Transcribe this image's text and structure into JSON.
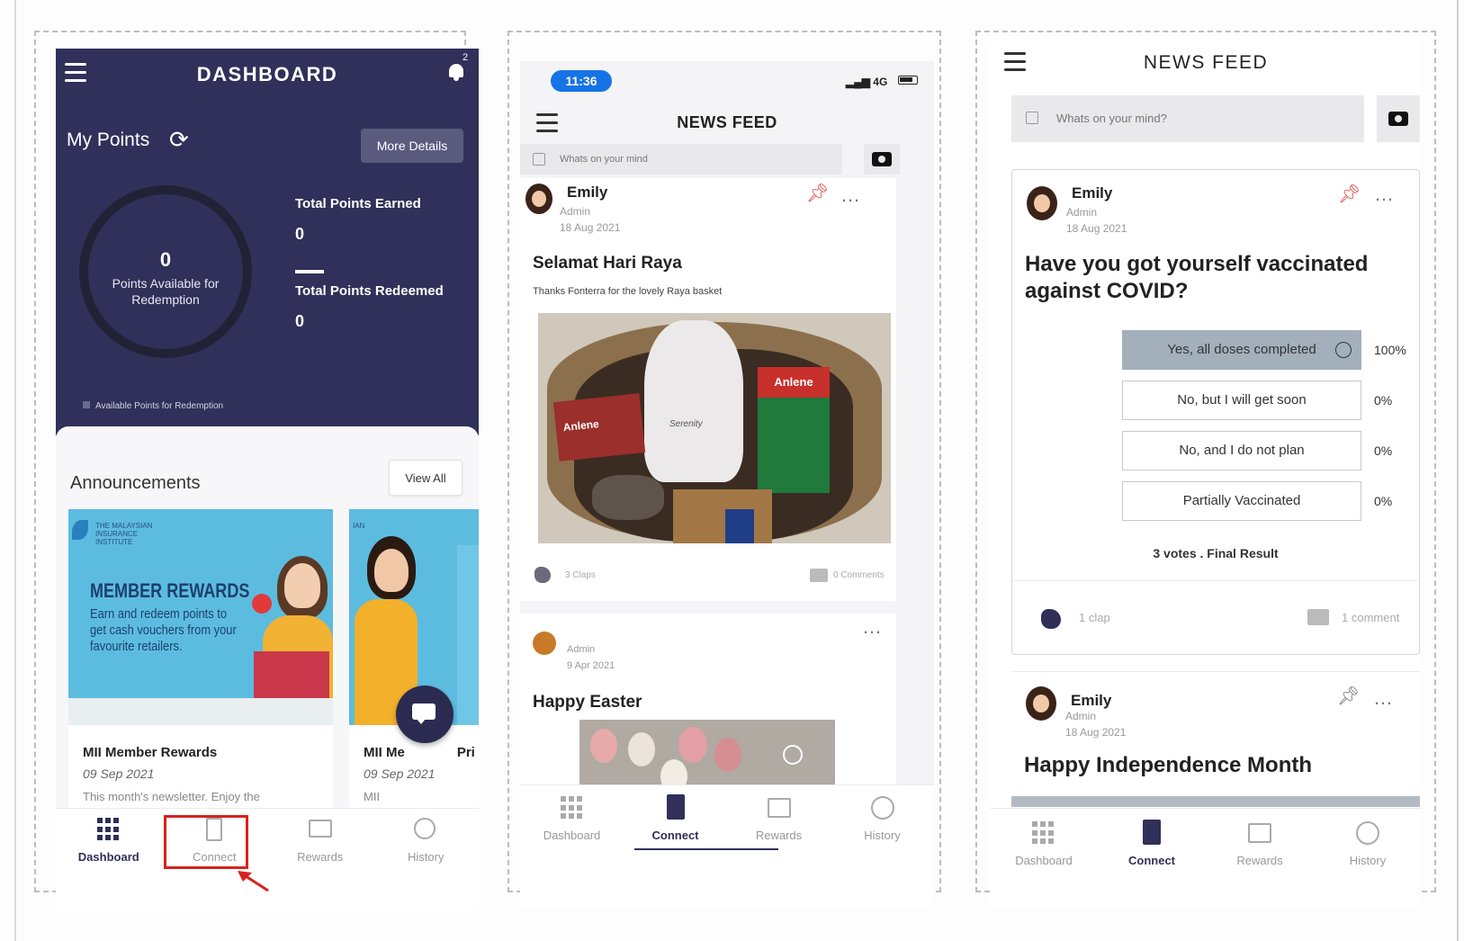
{
  "panel1": {
    "header": {
      "title": "DASHBOARD",
      "notification_count": "2"
    },
    "points": {
      "title": "My Points",
      "more_details": "More Details",
      "available_value": "0",
      "available_label": "Points Available for Redemption",
      "earned_label": "Total Points Earned",
      "earned_value": "0",
      "redeemed_label": "Total Points Redeemed",
      "redeemed_value": "0",
      "legend": "Available Points for Redemption"
    },
    "announcements": {
      "title": "Announcements",
      "view_all": "View All",
      "cards": [
        {
          "brand": "THE MALAYSIAN INSURANCE INSTITUTE",
          "banner_heading": "MEMBER REWARDS",
          "banner_text": "Earn and redeem points to get cash vouchers from your favourite retailers.",
          "title": "MII Member Rewards",
          "date": "09 Sep 2021",
          "snippet": "This month's newsletter. Enjoy the"
        },
        {
          "brand": "IAN",
          "title": "MII Me",
          "title_suffix": "Pri",
          "date": "09 Sep 2021",
          "snippet": "MII"
        }
      ]
    },
    "nav": [
      {
        "label": "Dashboard",
        "icon": "grid-icon",
        "active": true
      },
      {
        "label": "Connect",
        "icon": "document-icon",
        "active": false
      },
      {
        "label": "Rewards",
        "icon": "gift-icon",
        "active": false
      },
      {
        "label": "History",
        "icon": "history-icon",
        "active": false
      }
    ],
    "highlight_color": "#d9221e"
  },
  "panel2": {
    "status": {
      "time": "11:36",
      "network": "4G"
    },
    "title": "NEWS FEED",
    "compose_placeholder": "Whats on your mind",
    "post1": {
      "author": "Emily",
      "role": "Admin",
      "date": "18 Aug 2021",
      "title": "Selamat Hari Raya",
      "caption": "Thanks Fonterra for the lovely Raya basket",
      "photo_labels": {
        "left_box": "Anlene",
        "right_box": "Anlene",
        "tin": "Serenity"
      },
      "claps": "3 Claps",
      "comments": "0 Comments"
    },
    "post2": {
      "role": "Admin",
      "date": "9 Apr 2021",
      "title": "Happy Easter"
    },
    "nav": [
      {
        "label": "Dashboard",
        "icon": "grid-icon",
        "active": false
      },
      {
        "label": "Connect",
        "icon": "document-icon",
        "active": true
      },
      {
        "label": "Rewards",
        "icon": "gift-icon",
        "active": false
      },
      {
        "label": "History",
        "icon": "history-icon",
        "active": false
      }
    ]
  },
  "panel3": {
    "title": "NEWS FEED",
    "compose_placeholder": "Whats on your mind?",
    "post1": {
      "author": "Emily",
      "role": "Admin",
      "date": "18 Aug 2021",
      "question": "Have you got yourself vaccinated against COVID?",
      "options": [
        {
          "label": "Yes, all doses completed",
          "pct": "100%",
          "selected": true
        },
        {
          "label": "No, but I will get soon",
          "pct": "0%",
          "selected": false
        },
        {
          "label": "No, and I do not plan",
          "pct": "0%",
          "selected": false
        },
        {
          "label": "Partially Vaccinated",
          "pct": "0%",
          "selected": false
        }
      ],
      "result": "3 votes . Final Result",
      "claps": "1 clap",
      "comments": "1 comment"
    },
    "post2": {
      "author": "Emily",
      "role": "Admin",
      "date": "18 Aug 2021",
      "title": "Happy Independence Month"
    },
    "nav": [
      {
        "label": "Dashboard",
        "icon": "grid-icon",
        "active": false
      },
      {
        "label": "Connect",
        "icon": "document-icon",
        "active": true
      },
      {
        "label": "Rewards",
        "icon": "gift-icon",
        "active": false
      },
      {
        "label": "History",
        "icon": "history-icon",
        "active": false
      }
    ]
  },
  "colors": {
    "dashboard_bg": "#30305a",
    "accent_blue": "#1673e6",
    "pin_red": "#e54848",
    "poll_selected": "#a3b0bc"
  }
}
